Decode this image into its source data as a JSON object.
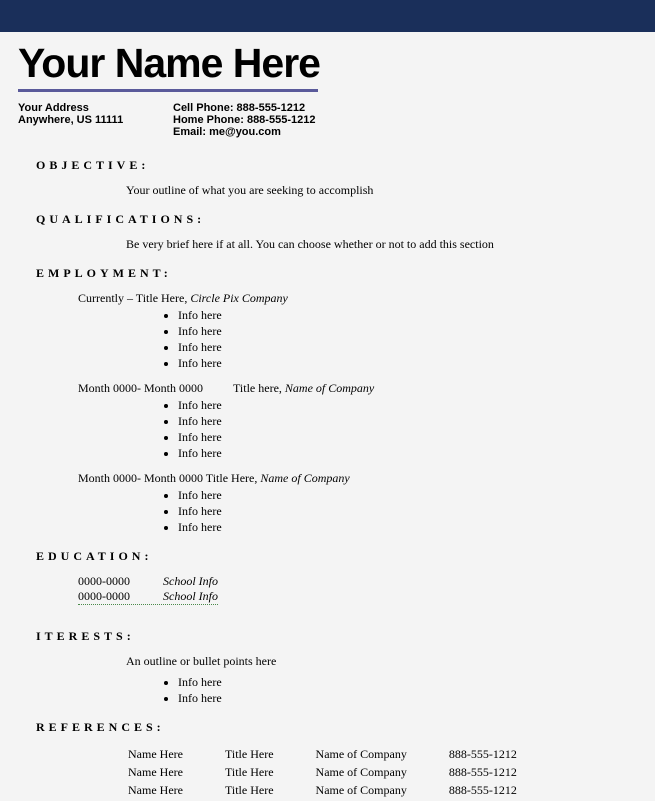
{
  "header": {
    "name": "Your Name Here",
    "address_line1": "Your Address",
    "address_line2": "Anywhere, US 11111",
    "cell_phone": "Cell Phone: 888-555-1212",
    "home_phone": "Home Phone: 888-555-1212",
    "email": "Email: me@you.com"
  },
  "objective": {
    "heading": "OBJECTIVE:",
    "text": "Your outline of what you are seeking to accomplish"
  },
  "qualifications": {
    "heading": "QUALIFICATIONS:",
    "text": "Be very brief here if at all. You can choose whether or not to add this section"
  },
  "employment": {
    "heading": "EMPLOYMENT:",
    "jobs": [
      {
        "date_prefix": "Currently – ",
        "title": "Title Here, ",
        "company": "Circle Pix Company",
        "bullets": [
          "Info here",
          "Info here",
          "Info here",
          "Info here"
        ]
      },
      {
        "date_prefix": "Month 0000- Month 0000",
        "spacer": "          ",
        "title": "Title here, ",
        "company": "Name of Company",
        "bullets": [
          "Info here",
          "Info here",
          "Info here",
          "Info here"
        ]
      },
      {
        "date_prefix": "Month 0000- Month 0000  ",
        "title": "Title Here, ",
        "company": "Name of Company",
        "bullets": [
          "Info here",
          "Info here",
          "Info here"
        ]
      }
    ]
  },
  "education": {
    "heading": "EDUCATION:",
    "rows": [
      {
        "dates": "0000-0000",
        "school": "School Info"
      },
      {
        "dates": "0000-0000",
        "school": "School Info"
      }
    ]
  },
  "interests": {
    "heading": "ITERESTS:",
    "text": "An outline or bullet points here",
    "bullets": [
      "Info here",
      "Info here"
    ]
  },
  "references": {
    "heading": "REFERENCES:",
    "rows": [
      {
        "name": "Name Here",
        "title": "Title Here",
        "company": "Name of Company",
        "phone": "888-555-1212"
      },
      {
        "name": "Name Here",
        "title": "Title Here",
        "company": "Name of Company",
        "phone": "888-555-1212"
      },
      {
        "name": "Name Here",
        "title": "Title Here",
        "company": "Name of Company",
        "phone": "888-555-1212"
      }
    ]
  }
}
